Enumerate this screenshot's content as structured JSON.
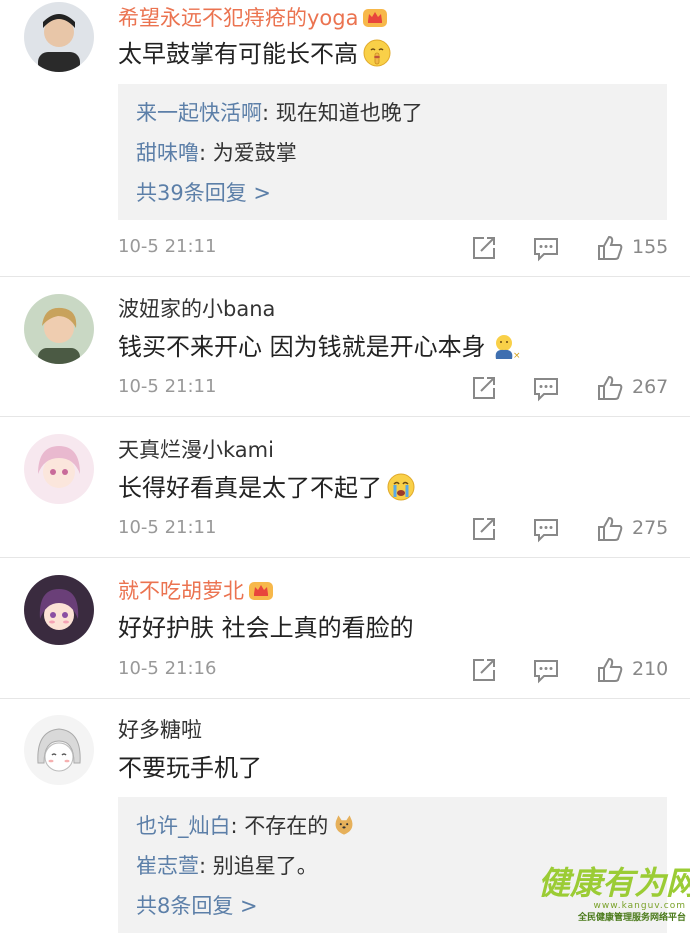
{
  "comments": [
    {
      "username": "希望永远不犯痔疮的yoga",
      "vip": true,
      "text": "太早鼓掌有可能长不高",
      "emoji": "shush-emoji",
      "replies": [
        {
          "name": "来一起快活啊",
          "sep": ": ",
          "text": "现在知道也晚了"
        },
        {
          "name": "甜味噜",
          "sep": ": ",
          "text": "为爱鼓掌"
        }
      ],
      "more": "共39条回复 >",
      "time": "10-5 21:11",
      "likes": "155"
    },
    {
      "username": "波妞家的小bana",
      "vip": false,
      "text": "钱买不来开心 因为钱就是开心本身",
      "emoji": "money-bag-emoji",
      "time": "10-5 21:11",
      "likes": "267"
    },
    {
      "username": "天真烂漫小kami",
      "vip": false,
      "text": "长得好看真是太了不起了",
      "emoji": "crying-emoji",
      "time": "10-5 21:11",
      "likes": "275"
    },
    {
      "username": "就不吃胡萝北",
      "vip": true,
      "text": "好好护肤 社会上真的看脸的",
      "time": "10-5 21:16",
      "likes": "210"
    },
    {
      "username": "好多糖啦",
      "vip": false,
      "text": "不要玩手机了",
      "replies": [
        {
          "name": "也许_灿白",
          "sep": ": ",
          "text": "不存在的",
          "emoji": "doge-emoji"
        },
        {
          "name": "崔志萱",
          "sep": ": ",
          "text": "别追星了。"
        }
      ],
      "more": "共8条回复 >"
    }
  ],
  "watermark": {
    "title": "健康有为网",
    "url": "www.kanguv.com",
    "subtitle": "全民健康管理服务网络平台"
  },
  "colors": {
    "vip_name": "#eb7350",
    "reply_name": "#5c7fa8",
    "reply_bg": "#f2f2f2",
    "meta": "#999999"
  }
}
